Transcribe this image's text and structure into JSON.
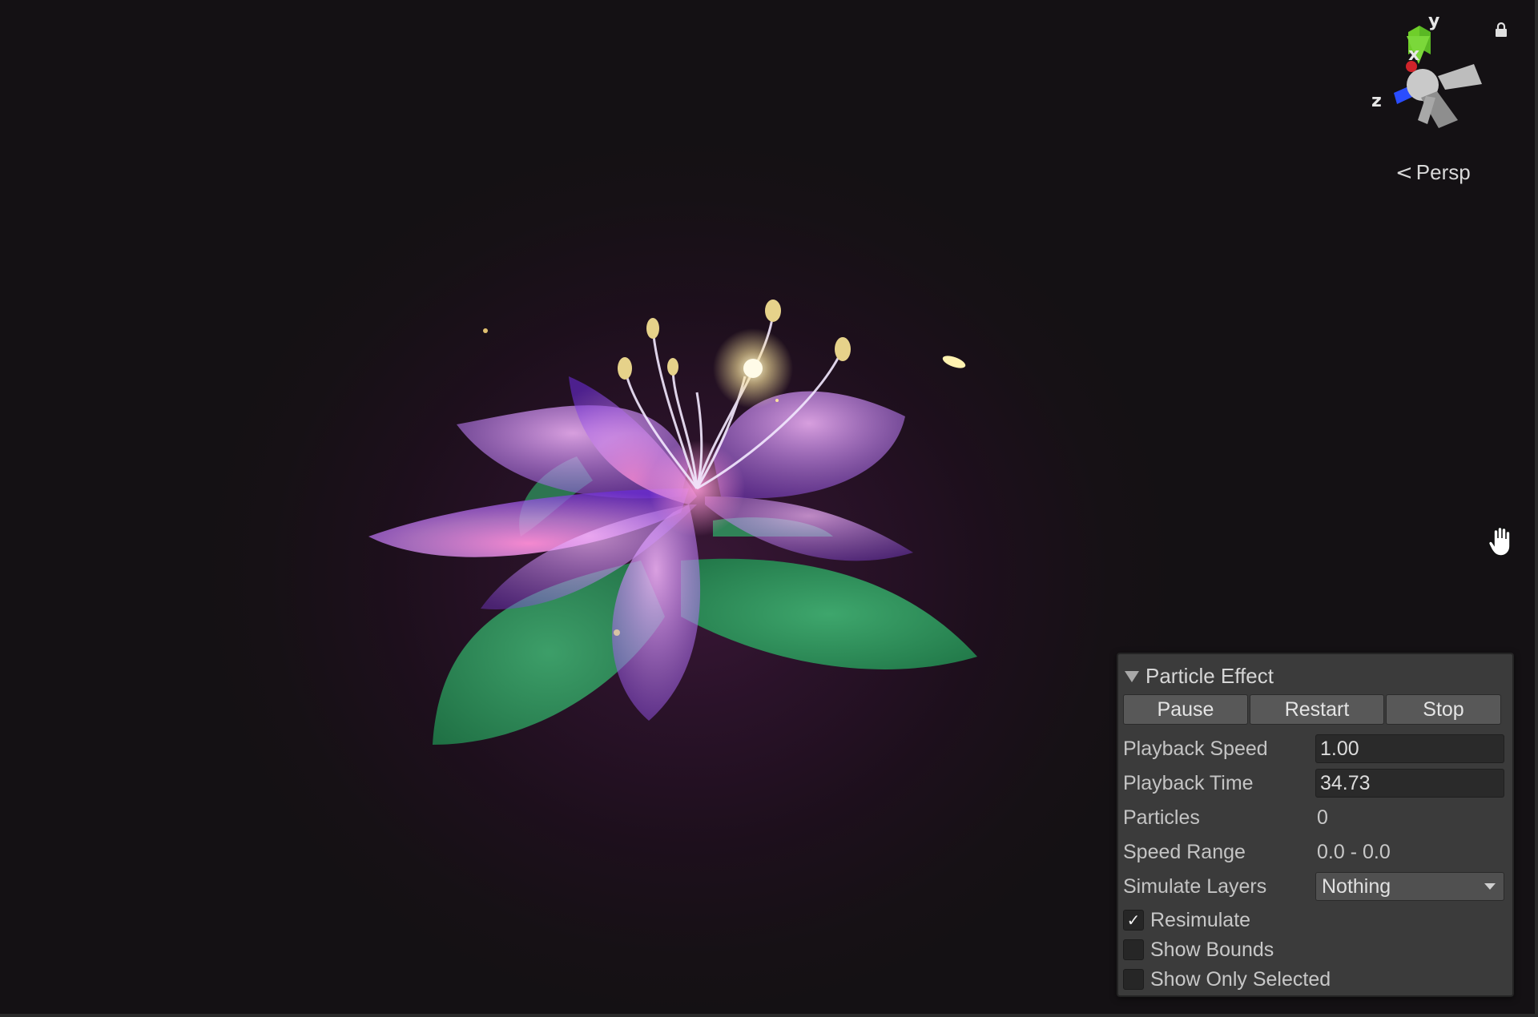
{
  "viewport": {
    "projection_label": "Persp",
    "axes": {
      "x": "x",
      "y": "y",
      "z": "z"
    },
    "colors": {
      "x_axis": "#d0242a",
      "y_axis": "#6fce2a",
      "z_axis": "#2a4dff",
      "background": "#141014"
    },
    "icons": [
      "lock-icon",
      "hand-icon",
      "chevron-left-icon"
    ]
  },
  "particle_panel": {
    "title": "Particle Effect",
    "buttons": {
      "pause": "Pause",
      "restart": "Restart",
      "stop": "Stop"
    },
    "fields": {
      "playback_speed": {
        "label": "Playback Speed",
        "value": "1.00"
      },
      "playback_time": {
        "label": "Playback Time",
        "value": "34.73"
      },
      "particles": {
        "label": "Particles",
        "value": "0"
      },
      "speed_range": {
        "label": "Speed Range",
        "value": "0.0 - 0.0"
      },
      "simulate_layers": {
        "label": "Simulate Layers",
        "value": "Nothing"
      }
    },
    "checkboxes": {
      "resimulate": {
        "label": "Resimulate",
        "checked": true,
        "mark": "✓"
      },
      "show_bounds": {
        "label": "Show Bounds",
        "checked": false
      },
      "show_only_selected": {
        "label": "Show Only Selected",
        "checked": false
      }
    }
  }
}
